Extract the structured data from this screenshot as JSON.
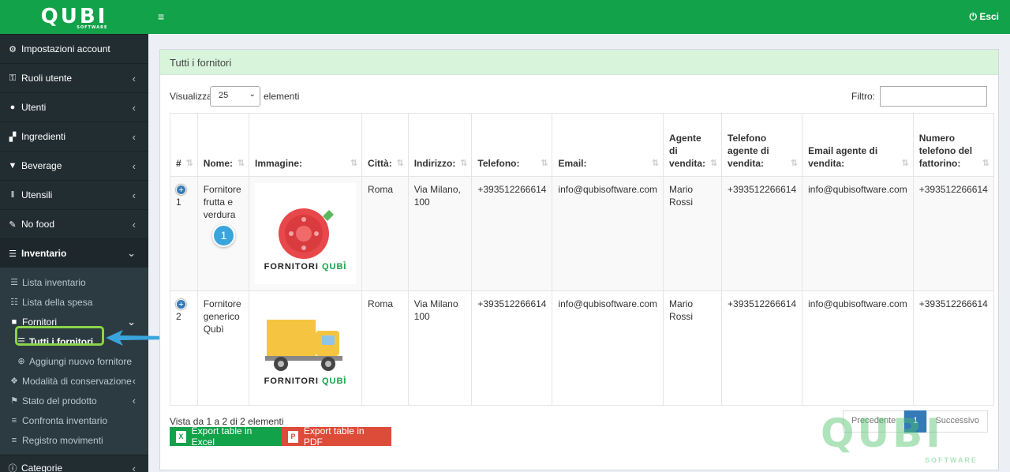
{
  "brand": {
    "logo": "QUBI",
    "logo_sub": "SOFTWARE"
  },
  "topbar": {
    "logout_label": "Esci"
  },
  "sidebar": {
    "items": [
      {
        "label": "Impostazioni account",
        "icon": "gear-icon",
        "glyph": "⚙",
        "chevron": ""
      },
      {
        "label": "Ruoli utente",
        "icon": "unlock-icon",
        "glyph": "🔓",
        "chevron": "‹"
      },
      {
        "label": "Utenti",
        "icon": "user-icon",
        "glyph": "👤",
        "chevron": "‹"
      },
      {
        "label": "Ingredienti",
        "icon": "sitemap-icon",
        "glyph": "▞",
        "chevron": "‹"
      },
      {
        "label": "Beverage",
        "icon": "filter-icon",
        "glyph": "▼",
        "chevron": "‹"
      },
      {
        "label": "Utensili",
        "icon": "cutlery-icon",
        "glyph": "Ⅱ",
        "chevron": "‹"
      },
      {
        "label": "No food",
        "icon": "wrench-icon",
        "glyph": "🔧",
        "chevron": "‹"
      },
      {
        "label": "Inventario",
        "icon": "list-icon",
        "glyph": "☰",
        "chevron": "⌄"
      }
    ],
    "inventario_sub": [
      {
        "label": "Lista inventario",
        "icon": "list-icon",
        "glyph": "☰"
      },
      {
        "label": "Lista della spesa",
        "icon": "list-check-icon",
        "glyph": "☷"
      },
      {
        "label": "Fornitori",
        "icon": "truck-icon",
        "glyph": "🚚"
      }
    ],
    "fornitori_sub": [
      {
        "label": "Tutti i fornitori",
        "icon": "list-icon",
        "glyph": "☰"
      },
      {
        "label": "Aggiungi nuovo fornitore",
        "icon": "plus-circle-icon",
        "glyph": "⊕"
      }
    ],
    "more_sub": [
      {
        "label": "Modalità di conservazione",
        "icon": "cubes-icon",
        "glyph": "❖",
        "chevron": "‹"
      },
      {
        "label": "Stato del prodotto",
        "icon": "flag-icon",
        "glyph": "⚑",
        "chevron": "‹"
      },
      {
        "label": "Confronta inventario",
        "icon": "bars-icon",
        "glyph": "≡",
        "chevron": ""
      },
      {
        "label": "Registro movimenti",
        "icon": "bars-icon",
        "glyph": "≡",
        "chevron": ""
      }
    ],
    "last": {
      "label": "Categorie",
      "icon": "info-circle-icon",
      "glyph": "ⓘ",
      "chevron": "‹"
    }
  },
  "box": {
    "title": "Tutti i fornitori"
  },
  "controls": {
    "show_label": "Visualizza",
    "page_size": "25",
    "elements_label": "elementi",
    "filter_label": "Filtro:",
    "filter_value": ""
  },
  "table": {
    "headers": [
      "#",
      "Nome:",
      "Immagine:",
      "Città:",
      "Indirizzo:",
      "Telefono:",
      "Email:",
      "Agente di vendita:",
      "Telefono agente di vendita:",
      "Email agente di vendita:",
      "Numero telefono del fattorino:"
    ],
    "rows": [
      {
        "id": "1",
        "name": "Fornitore frutta e verdura",
        "image": "tomato-image",
        "city": "Roma",
        "address": "Via Milano, 100",
        "phone": "+393512266614",
        "email": "info@qubisoftware.com",
        "agent": "Mario Rossi",
        "agent_phone": "+393512266614",
        "agent_email": "info@qubisoftware.com",
        "courier_phone": "+393512266614"
      },
      {
        "id": "2",
        "name": "Fornitore generico Qubì",
        "image": "truck-image",
        "city": "Roma",
        "address": "Via Milano 100",
        "phone": "+393512266614",
        "email": "info@qubisoftware.com",
        "agent": "Mario Rossi",
        "agent_phone": "+393512266614",
        "agent_email": "info@qubisoftware.com",
        "courier_phone": "+393512266614"
      }
    ],
    "image_brand_a": "FORNITORI ",
    "image_brand_b": "QUBÌ"
  },
  "footer": {
    "info": "Vista da 1 a 2 di 2 elementi",
    "excel": "Export table in Excel",
    "pdf": "Export table in PDF",
    "prev": "Precedente",
    "page": "1",
    "next": "Successivo"
  },
  "annotation": {
    "badge": "1"
  },
  "watermark": {
    "text": "QUBI",
    "sub": "SOFTWARE"
  }
}
